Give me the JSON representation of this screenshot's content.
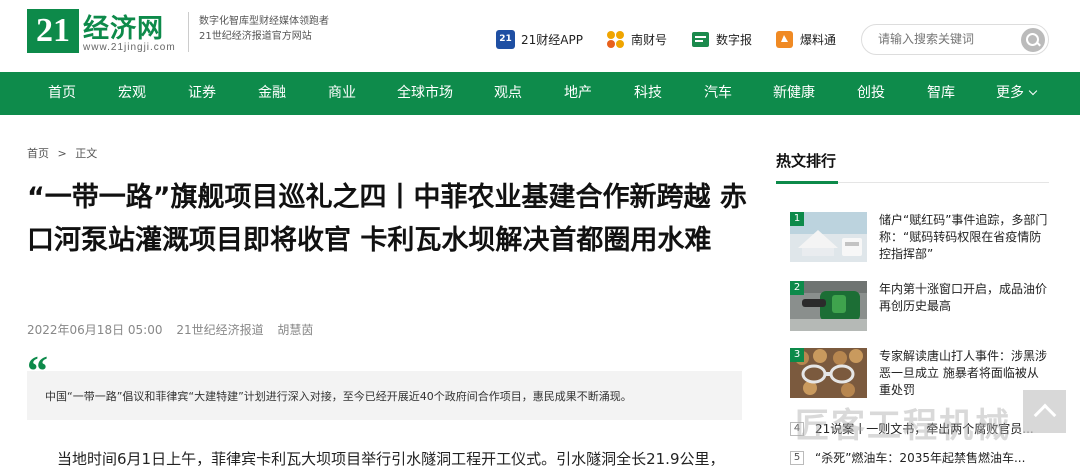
{
  "header": {
    "logo_number": "21",
    "logo_name": "经济网",
    "logo_url": "www.21jingji.com",
    "slogan_line1": "数字化智库型财经媒体领跑者",
    "slogan_line2": "21世纪经济报道官方网站",
    "links": [
      {
        "label": "21财经APP",
        "icon": "app-21-icon"
      },
      {
        "label": "南财号",
        "icon": "nancai-dots-icon"
      },
      {
        "label": "数字报",
        "icon": "digital-paper-icon"
      },
      {
        "label": "爆料通",
        "icon": "tip-off-icon"
      }
    ],
    "search_placeholder": "请输入搜索关键词"
  },
  "nav": {
    "items": [
      "首页",
      "宏观",
      "证券",
      "金融",
      "商业",
      "全球市场",
      "观点",
      "地产",
      "科技",
      "汽车",
      "新健康",
      "创投",
      "智库",
      "更多"
    ]
  },
  "breadcrumb": {
    "home": "首页",
    "sep": ">",
    "current": "正文"
  },
  "article": {
    "title": "“一带一路”旗舰项目巡礼之四丨中菲农业基建合作新跨越 赤口河泵站灌溉项目即将收官 卡利瓦水坝解决首都圈用水难",
    "date": "2022年06月18日 05:00",
    "source": "21世纪经济报道",
    "author": "胡慧茵",
    "quote_mark": "“",
    "summary": "中国“一带一路”倡议和菲律宾“大建特建”计划进行深入对接，至今已经开展近40个政府间合作项目，惠民成果不断涌现。",
    "body_first_line": "当地时间6月1日上午，菲律宾卡利瓦大坝项目举行引水隧洞工程开工仪式。引水隧洞全长21.9公里，"
  },
  "hot": {
    "title": "热文排行",
    "items": [
      {
        "rank": "1",
        "text": "储户“赋红码”事件追踪，多部门称：“赋码转码权限在省疫情防控指挥部”"
      },
      {
        "rank": "2",
        "text": "年内第十涨窗口开启，成品油价再创历史最高"
      },
      {
        "rank": "3",
        "text": "专家解读唐山打人事件：涉黑涉恶一旦成立 施暴者将面临被从重处罚"
      }
    ],
    "small_items": [
      {
        "rank": "4",
        "text": "21说案丨一则文书，牵出两个腐败官员..."
      },
      {
        "rank": "5",
        "text": "“杀死”燃油车：2035年起禁售燃油车..."
      }
    ]
  },
  "watermark": "匠客工程机械",
  "colors": {
    "brand_green": "#0e8b4b",
    "quote_bg": "#f3f3f3"
  }
}
